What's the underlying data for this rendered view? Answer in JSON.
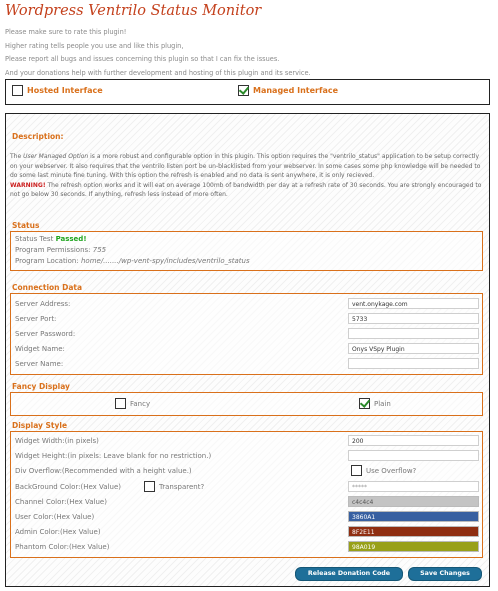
{
  "page": {
    "title": "Wordpress Ventrilo Status Monitor",
    "intro": [
      "Please make sure to rate this plugin!",
      "Higher rating tells people you use and like this plugin,",
      "Please report all bugs and issues concerning this plugin so that I can fix the issues.",
      "And your donations help with further development and hosting of this plugin and its service."
    ]
  },
  "interface": {
    "hosted": {
      "label": "Hosted Interface",
      "checked": false
    },
    "managed": {
      "label": "Managed Interface",
      "checked": true
    }
  },
  "description": {
    "heading": "Description:",
    "line1_prefix": "The ",
    "line1_em": "User Managed Option",
    "line1_rest": " is a more robust and configurable option in this plugin.  This option requires the \"ventrilo_status\" application to be setup correctly on your webserver.  It also requires that the ventrilo listen port be un-blacklisted from your webserver.  In some cases some php knowledge will be needed to do some last minute fine tuning. With this option the refresh is enabled and no data is sent anywhere, it is only recieved.",
    "warning_label": "WARNING!",
    "warning_text": " The refresh option works and it will eat on average 100mb of bandwidth per day at a refresh rate of 30 seconds.  You are strongly encouraged to not go below 30 seconds.  If anything, refresh less instead of more often."
  },
  "status": {
    "heading": "Status",
    "test_label": "Status Test",
    "test_result": "Passed!",
    "perm_label": "Program Permissions:",
    "perm_value": "755",
    "loc_label": "Program Location:",
    "loc_value": "home/......./wp-vent-spy/includes/ventrilo_status"
  },
  "connection": {
    "heading": "Connection Data",
    "fields": [
      {
        "label": "Server Address:",
        "value": "vent.onykage.com"
      },
      {
        "label": "Server Port:",
        "value": "5733"
      },
      {
        "label": "Server Password:",
        "value": ""
      },
      {
        "label": "Widget Name:",
        "value": "Onys VSpy Plugin"
      },
      {
        "label": "Server Name:",
        "value": ""
      }
    ]
  },
  "fancy": {
    "heading": "Fancy Display",
    "fancy_label": "Fancy",
    "plain_label": "Plain",
    "fancy_checked": false,
    "plain_checked": true
  },
  "display": {
    "heading": "Display Style",
    "width_label": "Widget Width:(in pixels)",
    "width_value": "200",
    "height_label": "Widget Height:(in pixels: Leave blank for no restriction.)",
    "height_value": "",
    "overflow_label": "Div Overflow:(Recommended with a height value.)",
    "overflow_option": "Use Overflow?",
    "bg_label": "BackGround Color:(Hex Value)",
    "bg_transparent": "Transparent?",
    "bg_value": "*****",
    "channel_label": "Channel Color:(Hex Value)",
    "channel_value": "c4c4c4",
    "user_label": "User Color:(Hex Value)",
    "user_value": "3860A1",
    "admin_label": "Admin Color:(Hex Value)",
    "admin_value": "8F2E11",
    "phantom_label": "Phantom Color:(Hex Value)",
    "phantom_value": "98A019",
    "colors": {
      "channel": "#c4c4c4",
      "user": "#3860A1",
      "admin": "#8F2E11",
      "phantom": "#98A019"
    }
  },
  "buttons": {
    "donation": "Release Donation Code",
    "save": "Save Changes"
  }
}
